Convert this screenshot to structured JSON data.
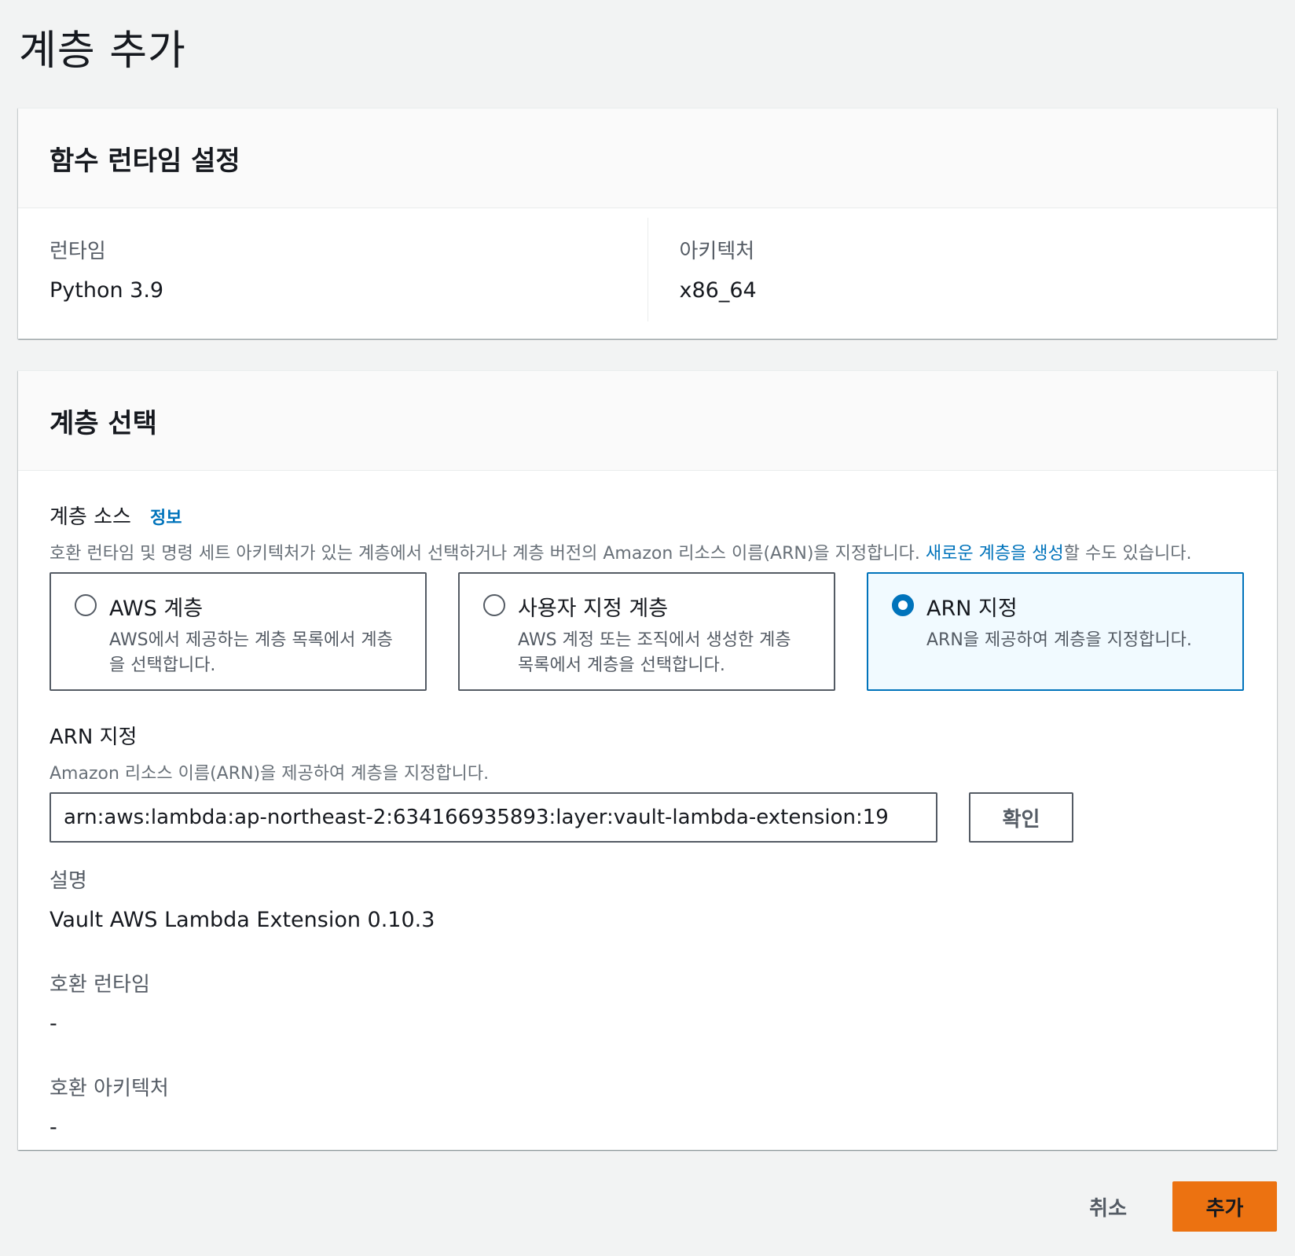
{
  "page": {
    "title": "계층 추가"
  },
  "runtime_settings": {
    "header": "함수 런타임 설정",
    "runtime_label": "런타임",
    "runtime_value": "Python 3.9",
    "architecture_label": "아키텍처",
    "architecture_value": "x86_64"
  },
  "layer_select": {
    "header": "계층 선택",
    "source_label": "계층 소스",
    "info_link": "정보",
    "source_desc_prefix": "호환 런타임 및 명령 세트 아키텍처가 있는 계층에서 선택하거나 계층 버전의 Amazon 리소스 이름(ARN)을 지정합니다. ",
    "source_desc_link": "새로운 계층을 생성",
    "source_desc_suffix": "할 수도 있습니다.",
    "options": [
      {
        "title": "AWS 계층",
        "desc_line1": "AWS에서 제공하는 계층 목록에서 계층",
        "desc_line2": "을 선택합니다.",
        "selected": false
      },
      {
        "title": "사용자 지정 계층",
        "desc_line1": "AWS 계정 또는 조직에서 생성한 계층",
        "desc_line2": "목록에서 계층을 선택합니다.",
        "selected": false
      },
      {
        "title": "ARN 지정",
        "desc_line1": "ARN을 제공하여 계층을 지정합니다.",
        "desc_line2": "",
        "selected": true
      }
    ],
    "arn_label": "ARN 지정",
    "arn_desc": "Amazon 리소스 이름(ARN)을 제공하여 계층을 지정합니다.",
    "arn_value": "arn:aws:lambda:ap-northeast-2:634166935893:layer:vault-lambda-extension:19",
    "confirm_button": "확인",
    "description_label": "설명",
    "description_value": "Vault AWS Lambda Extension 0.10.3",
    "compatible_runtime_label": "호환 런타임",
    "compatible_runtime_value": "-",
    "compatible_arch_label": "호환 아키텍처",
    "compatible_arch_value": "-"
  },
  "footer": {
    "cancel_button": "취소",
    "add_button": "추가"
  },
  "colors": {
    "accent": "#0073bb",
    "primary_button": "#ec7211",
    "background": "#f2f3f3"
  }
}
